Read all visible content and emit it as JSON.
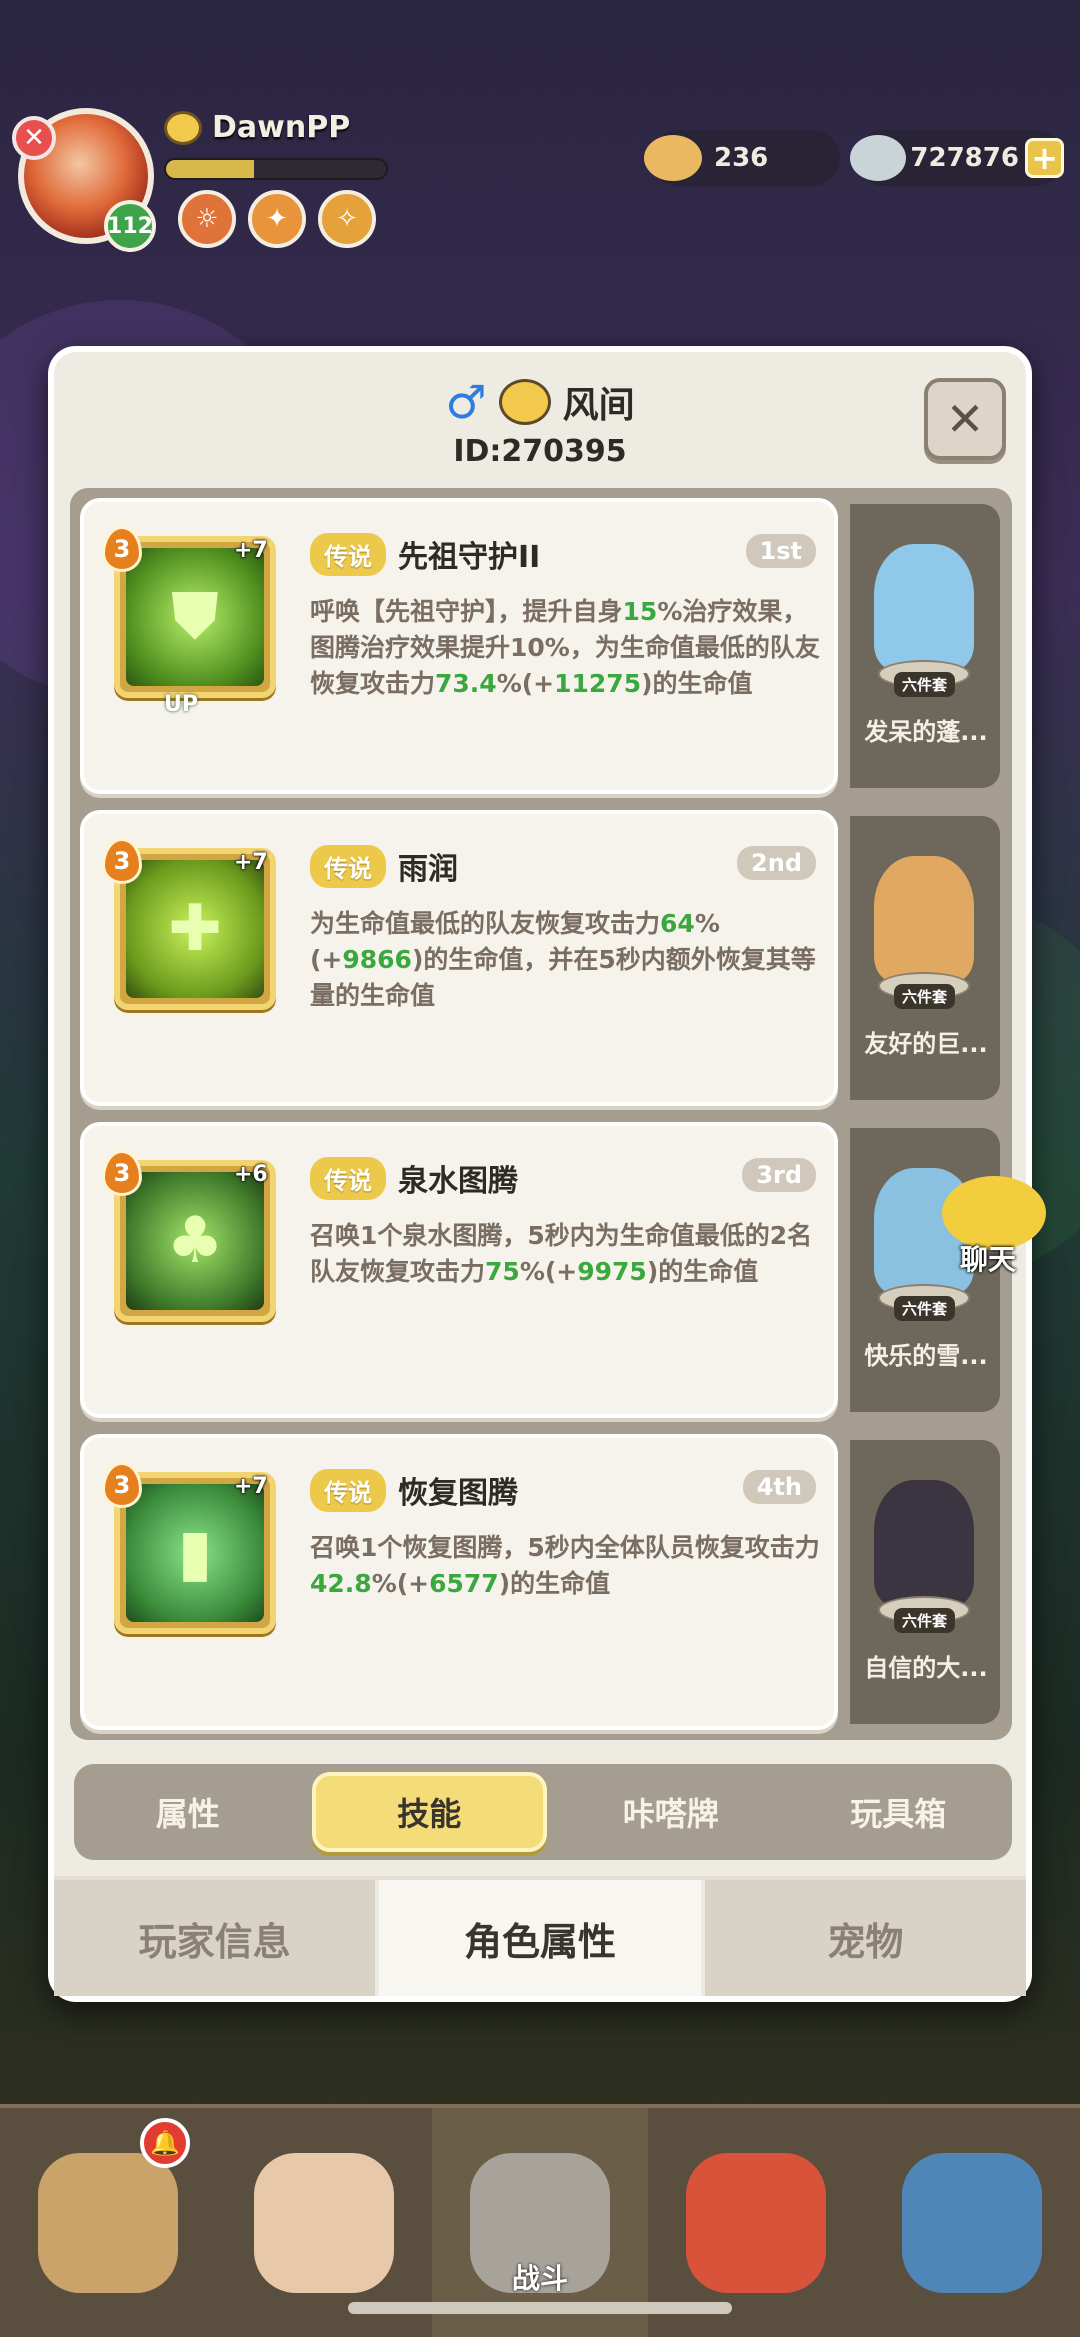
{
  "hud": {
    "player_name": "DawnPP",
    "level": "112",
    "exp_fraction": 0.4,
    "currency_1": "236",
    "currency_2": "727876"
  },
  "modal": {
    "name": "风间",
    "id_label": "ID:270395",
    "skills": [
      {
        "rank": "3",
        "plus": "+7",
        "up": "UP",
        "rarity": "传说",
        "name": "先祖守护II",
        "order": "1st",
        "desc_parts": [
          "呼唤【先祖守护】，提升自身",
          "15",
          "%治疗效果，图腾治疗效果提升10%，为生命值最低的队友恢复攻击力",
          "73.4",
          "%(+",
          "11275",
          ")的生命值"
        ],
        "outfit_set": "六件套",
        "outfit_name": "发呆的蓬..."
      },
      {
        "rank": "3",
        "plus": "+7",
        "rarity": "传说",
        "name": "雨润",
        "order": "2nd",
        "desc_parts": [
          "为生命值最低的队友恢复攻击力",
          "64",
          "%(+",
          "9866",
          ")的生命值，并在5秒内额外恢复其等量的生命值"
        ],
        "outfit_set": "六件套",
        "outfit_name": "友好的巨..."
      },
      {
        "rank": "3",
        "plus": "+6",
        "rarity": "传说",
        "name": "泉水图腾",
        "order": "3rd",
        "desc_parts": [
          "召唤1个泉水图腾，5秒内为生命值最低的2名队友恢复攻击力",
          "75",
          "%(+",
          "9975",
          ")的生命值"
        ],
        "outfit_set": "六件套",
        "outfit_name": "快乐的雪..."
      },
      {
        "rank": "3",
        "plus": "+7",
        "rarity": "传说",
        "name": "恢复图腾",
        "order": "4th",
        "desc_parts": [
          "召唤1个恢复图腾，5秒内全体队员恢复攻击力",
          "42.8",
          "%(+",
          "6577",
          ")的生命值"
        ],
        "outfit_set": "六件套",
        "outfit_name": "自信的大..."
      }
    ],
    "sub_tabs": [
      "属性",
      "技能",
      "咔嗒牌",
      "玩具箱"
    ],
    "main_tabs": [
      "玩家信息",
      "角色属性",
      "宠物"
    ]
  },
  "chat": {
    "label": "聊天"
  },
  "bottom_nav": {
    "battle_label": "战斗"
  },
  "colors": {
    "highlight_green": "#3aa83f",
    "rarity_gold": "#ecc94a",
    "panel_bg": "#eeebe2"
  },
  "icons": [
    "close-icon",
    "male-icon",
    "face-icon",
    "plus-icon",
    "bell-icon",
    "chat-icon"
  ]
}
